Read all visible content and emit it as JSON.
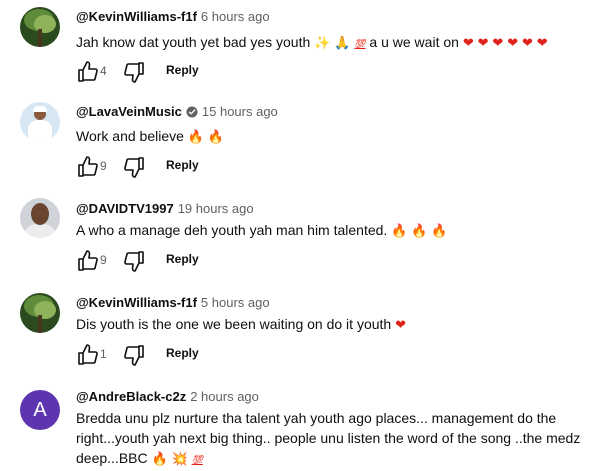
{
  "comments": [
    {
      "author": "@KevinWilliams-f1f",
      "time": "6 hours ago",
      "text": "Jah know dat youth yet bad yes youth",
      "text2": "a u we wait on",
      "emoji_a": [
        "✨",
        "🙏",
        "💯"
      ],
      "hearts": [
        "❤",
        "❤",
        "❤",
        "❤",
        "❤",
        "❤"
      ],
      "likes": "4",
      "reply_label": "Reply",
      "avatar": "tree-avatar"
    },
    {
      "author": "@LavaVeinMusic",
      "time": "15 hours ago",
      "text": "Work and believe",
      "emoji": [
        "🔥",
        "🔥"
      ],
      "likes": "9",
      "reply_label": "Reply",
      "avatar": "person-white-cap-avatar",
      "verified_icon": "verified-check-icon"
    },
    {
      "author": "@DAVIDTV1997",
      "time": "19 hours ago",
      "text": "A who a manage deh youth yah man him talented.",
      "emoji": [
        "🔥",
        "🔥",
        "🔥"
      ],
      "likes": "9",
      "reply_label": "Reply",
      "avatar": "person-photo-avatar"
    },
    {
      "author": "@KevinWilliams-f1f",
      "time": "5 hours ago",
      "text": "Dis youth is the one we been waiting on do it youth",
      "emoji": [
        "❤"
      ],
      "likes": "1",
      "reply_label": "Reply",
      "avatar": "tree-avatar"
    },
    {
      "author": "@AndreBlack-c2z",
      "time": "2 hours ago",
      "avatar_letter": "A",
      "line1": "Bredda unu plz nurture tha talent yah youth ago places... management do the",
      "line2": "right...youth yah next big thing.. people unu listen the word of the song ..the medz",
      "line3": "deep...BBC",
      "emoji": [
        "🔥",
        "💥",
        "💯"
      ],
      "avatar_color": "#5e35b1"
    }
  ],
  "colors": {
    "text": "#0f0f0f",
    "secondary": "#606060",
    "heart": "#e0231a",
    "fire": "#f26a1b"
  },
  "icons": [
    "thumbs-up-icon",
    "thumbs-down-icon",
    "verified-check-icon"
  ]
}
